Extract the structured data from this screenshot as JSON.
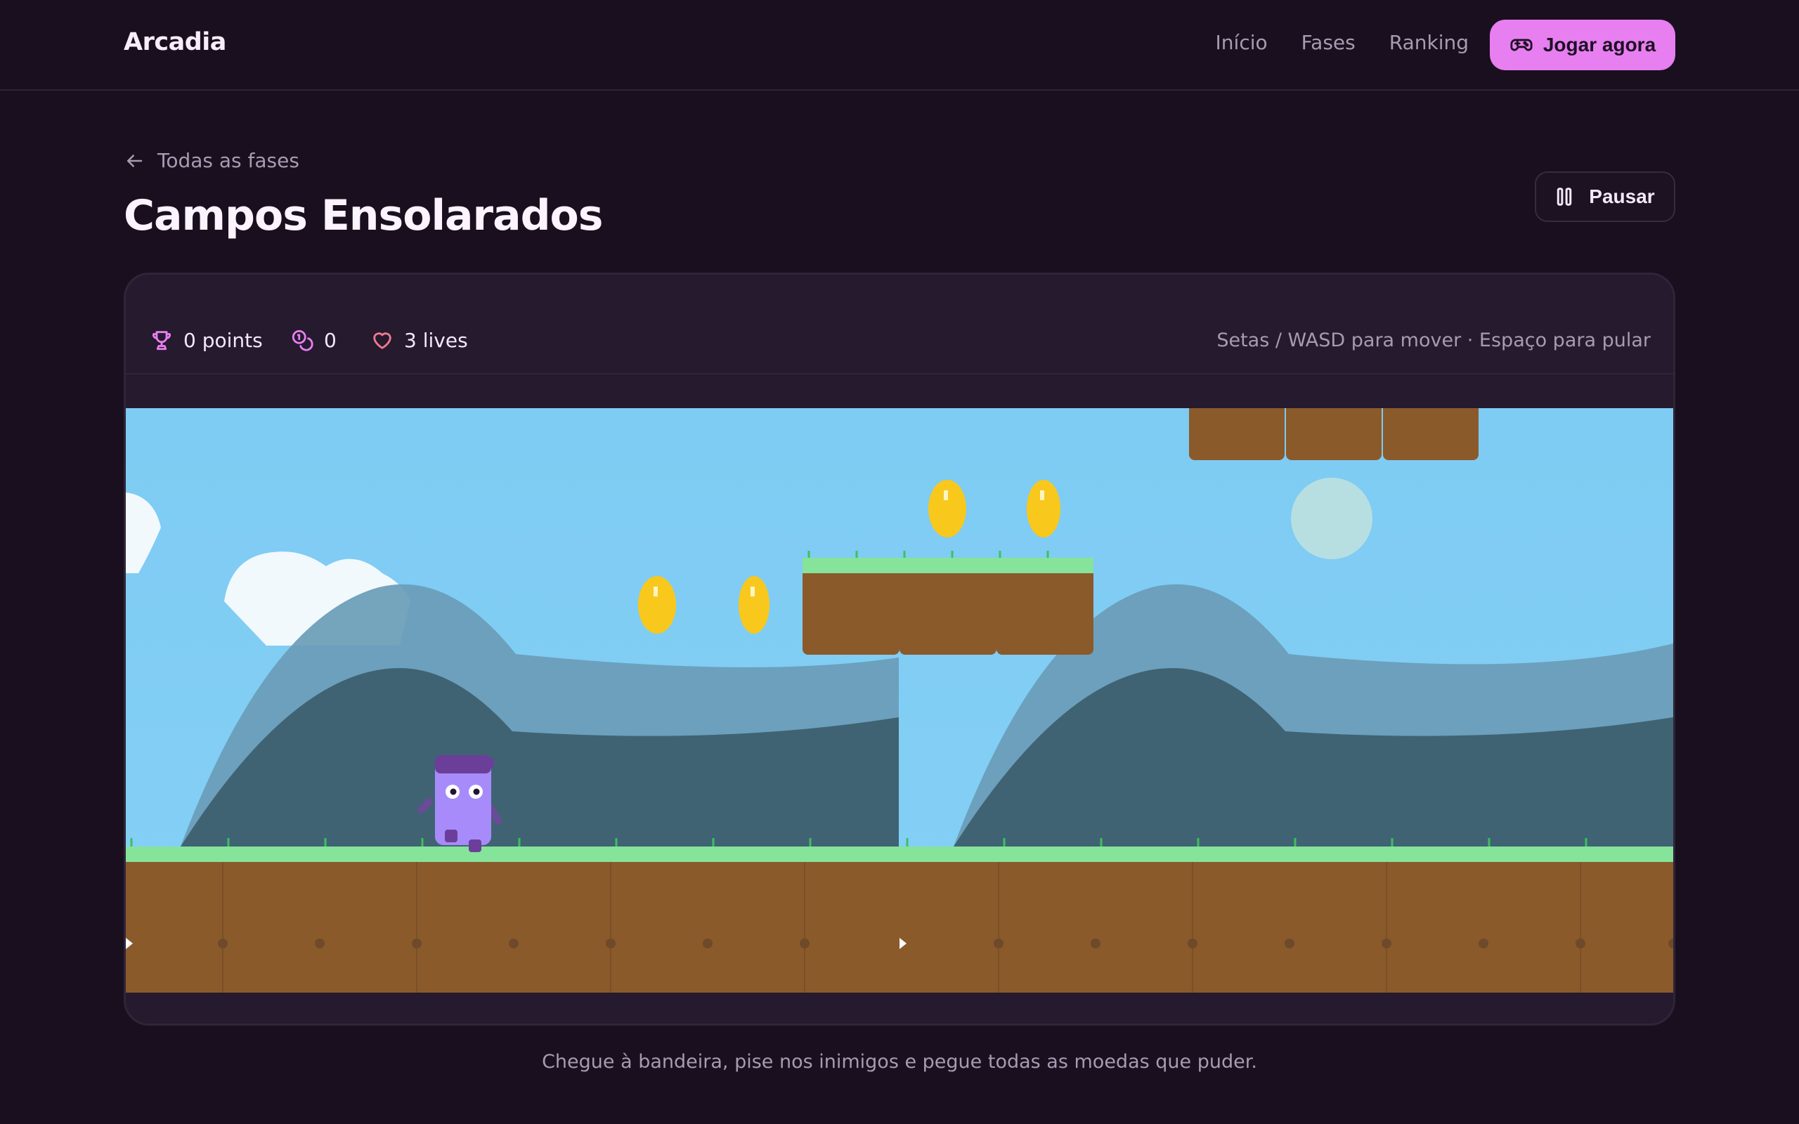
{
  "header": {
    "brand": "Arcadia",
    "nav": [
      "Início",
      "Fases",
      "Ranking"
    ],
    "play_label": "Jogar agora",
    "play_icon": "gamepad-icon"
  },
  "level": {
    "back_label": "Todas as fases",
    "title": "Campos Ensolarados",
    "pause_label": "Pausar"
  },
  "hud": {
    "points": "0 points",
    "coins": "0",
    "lives": "3 lives",
    "hint": "Setas / WASD para mover · Espaço para pular"
  },
  "footer": {
    "note": "Chegue à bandeira, pise nos inimigos e pegue todas as moedas que puder."
  },
  "colors": {
    "background": "#1a0f1f",
    "accent": "#e77ff0",
    "sky": "#7ecbf3",
    "grass": "#86e39a",
    "dirt": "#8a5a2b",
    "coin": "#f8c81c",
    "player": "#a78bfa"
  }
}
